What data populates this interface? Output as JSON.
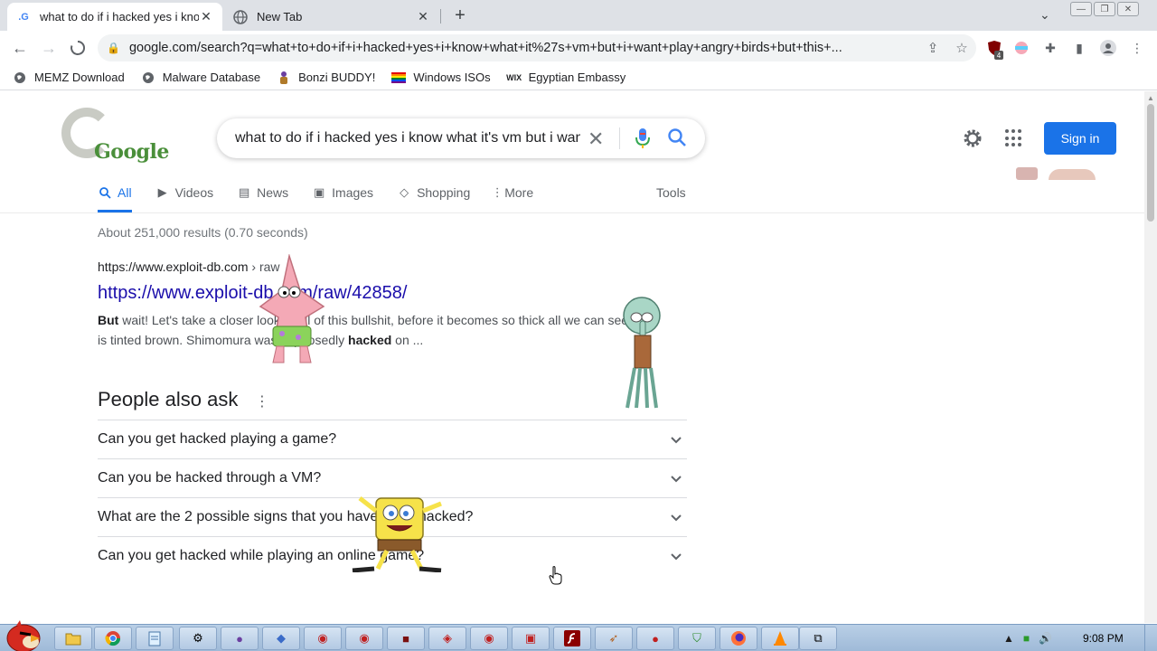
{
  "browser": {
    "tabs": [
      {
        "title": "what to do if i hacked yes i kno",
        "active": true,
        "favicon": "google-g-icon"
      },
      {
        "title": "New Tab",
        "active": false,
        "favicon": "chrome-globe-icon"
      }
    ],
    "new_tab_symbol": "+",
    "url": "google.com/search?q=what+to+do+if+i+hacked+yes+i+know+what+it%27s+vm+but+i+want+play+angry+birds+but+this+...",
    "extension_badge": "4",
    "bookmarks": [
      {
        "label": "MEMZ Download",
        "icon": "globe-icon"
      },
      {
        "label": "Malware Database",
        "icon": "globe-icon"
      },
      {
        "label": "Bonzi BUDDY!",
        "icon": "bonzi-icon"
      },
      {
        "label": "Windows ISOs",
        "icon": "rainbow-flag-icon"
      },
      {
        "label": "Egyptian Embassy",
        "icon": "wix-icon"
      }
    ]
  },
  "google": {
    "logo_text": "Google",
    "query": "what to do if i hacked yes i know what it's vm but i want",
    "sign_in": "Sign in",
    "nav_tabs": [
      {
        "label": "All",
        "icon": "search-icon",
        "active": true
      },
      {
        "label": "Videos",
        "icon": "video-icon",
        "active": false
      },
      {
        "label": "News",
        "icon": "news-icon",
        "active": false
      },
      {
        "label": "Images",
        "icon": "image-icon",
        "active": false
      },
      {
        "label": "Shopping",
        "icon": "tag-icon",
        "active": false
      },
      {
        "label": "More",
        "icon": "more-vert-icon",
        "active": false
      }
    ],
    "tools_label": "Tools",
    "result_stats": "About 251,000 results (0.70 seconds)",
    "result": {
      "cite_domain": "https://www.exploit-db.com",
      "cite_path": " › raw",
      "title": "https://www.exploit-db.com/raw/42858/",
      "snippet_lead": "But",
      "snippet_mid": " wait! Let's take a closer look at all of this bullshit, before it becomes so thick all we can see is tinted brown. Shimomura was supposedly ",
      "snippet_bold": "hacked",
      "snippet_tail": " on ..."
    },
    "people_also_ask": {
      "title": "People also ask",
      "questions": [
        "Can you get hacked playing a game?",
        "Can you be hacked through a VM?",
        "What are the 2 possible signs that you have been hacked?",
        "Can you get hacked while playing an online game?"
      ]
    }
  },
  "taskbar": {
    "clock": "9:08 PM",
    "apps": [
      "folder-icon",
      "chrome-icon",
      "notepad-icon",
      "settings-icon",
      "bonzi-icon",
      "paint-icon",
      "app-icon",
      "app-icon",
      "app-icon",
      "app-icon",
      "app-icon",
      "app-icon",
      "flash-icon",
      "app-icon",
      "app-icon",
      "shield-icon",
      "firefox-icon",
      "vlc-icon",
      "window-icon"
    ]
  },
  "colors": {
    "link": "#1a0dab",
    "accent": "#1a73e8",
    "taskbar": "#b9cfe6"
  }
}
